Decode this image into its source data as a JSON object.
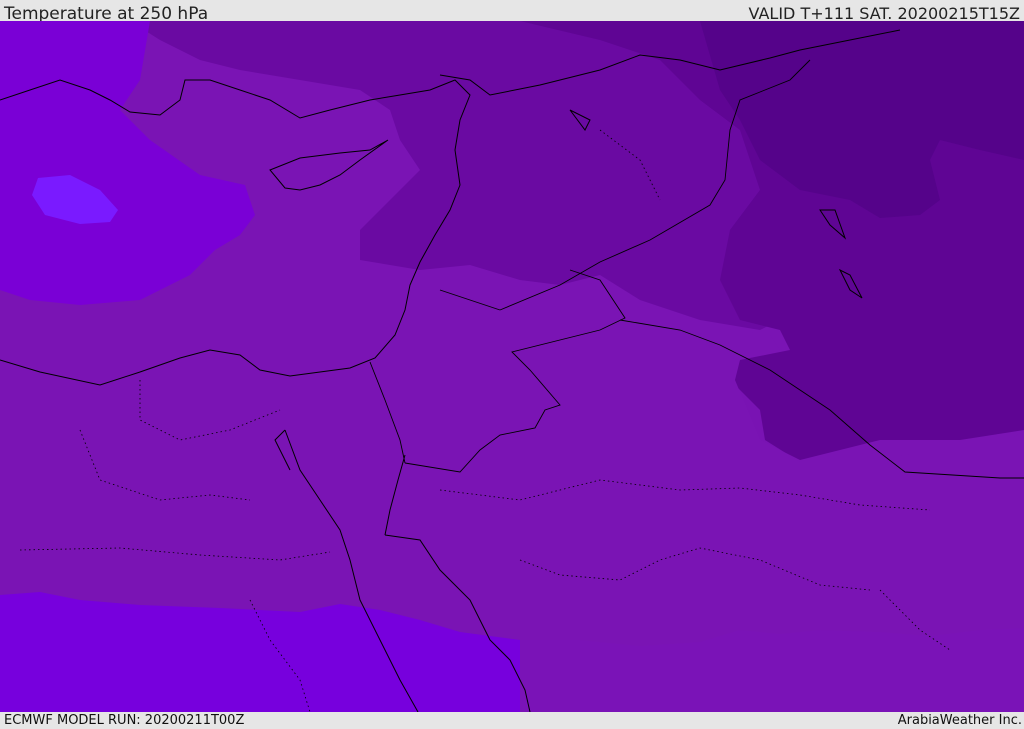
{
  "header": {
    "title": "Temperature at 250 hPa",
    "valid_time": "VALID T+111 SAT. 20200215T15Z"
  },
  "footer": {
    "model_run": "ECMWF MODEL RUN: 20200211T00Z",
    "credit": "ArabiaWeather Inc."
  },
  "map": {
    "colors": {
      "bright_purple": "#7700dd",
      "light_blob": "#7a1aff",
      "mid_purple": "#7a14b4",
      "dark_purple": "#6a0aa2",
      "darker_purple": "#5f0594",
      "darkest_purple": "#55038a",
      "coastline": "#000000"
    }
  }
}
